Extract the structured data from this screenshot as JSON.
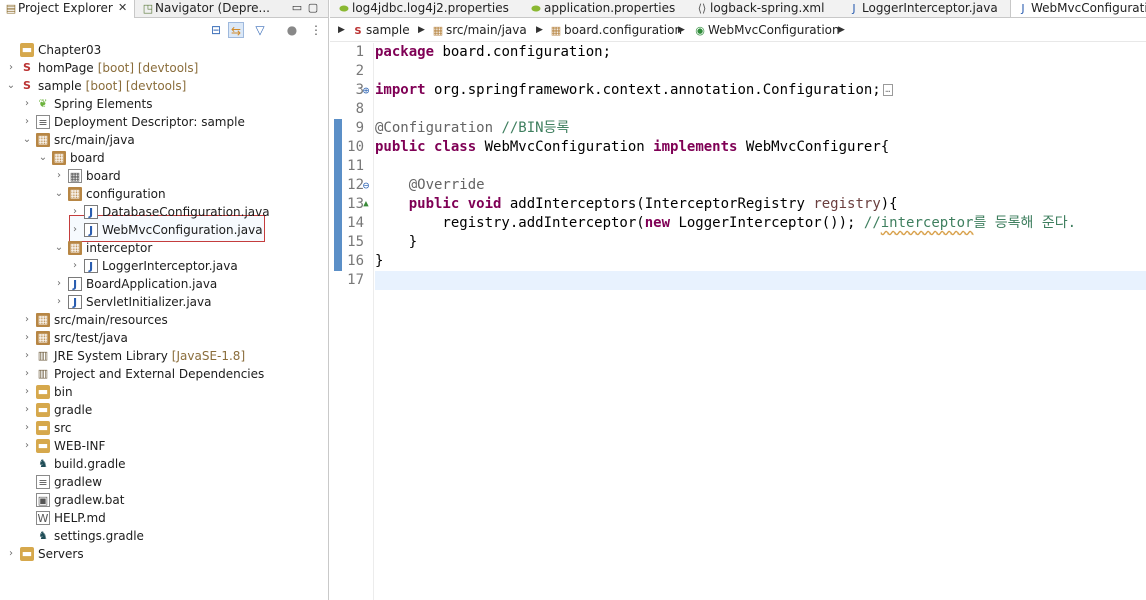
{
  "left_panel": {
    "tabs": [
      {
        "label": "Project Explorer",
        "icon": "project-explorer-icon"
      },
      {
        "label": "Navigator (Depre...",
        "icon": "navigator-icon"
      }
    ],
    "close_glyph": "✕",
    "minimize_glyph": "▭",
    "maximize_glyph": "▢",
    "toolbar": [
      "collapse-all-icon",
      "link-with-editor-icon",
      "filter-icon",
      "focus-icon",
      "view-menu-icon"
    ],
    "tree": [
      {
        "label": "Chapter03",
        "decor": "",
        "icon": "folder"
      },
      {
        "label": "homPage",
        "decor": "[boot] [devtools]",
        "icon": "project"
      },
      {
        "label": "sample",
        "decor": "[boot] [devtools]",
        "icon": "project"
      },
      {
        "label": "Spring Elements",
        "decor": "",
        "icon": "spring"
      },
      {
        "label": "Deployment Descriptor: sample",
        "decor": "",
        "icon": "descriptor"
      },
      {
        "label": "src/main/java",
        "decor": "",
        "icon": "source-folder"
      },
      {
        "label": "board",
        "decor": "",
        "icon": "package"
      },
      {
        "label": "board",
        "decor": "",
        "icon": "package-empty"
      },
      {
        "label": "configuration",
        "decor": "",
        "icon": "package"
      },
      {
        "label": "DatabaseConfiguration.java",
        "decor": "",
        "icon": "java"
      },
      {
        "label": "WebMvcConfiguration.java",
        "decor": "",
        "icon": "java"
      },
      {
        "label": "interceptor",
        "decor": "",
        "icon": "package"
      },
      {
        "label": "LoggerInterceptor.java",
        "decor": "",
        "icon": "java"
      },
      {
        "label": "BoardApplication.java",
        "decor": "",
        "icon": "java"
      },
      {
        "label": "ServletInitializer.java",
        "decor": "",
        "icon": "java"
      },
      {
        "label": "src/main/resources",
        "decor": "",
        "icon": "source-folder"
      },
      {
        "label": "src/test/java",
        "decor": "",
        "icon": "source-folder"
      },
      {
        "label": "JRE System Library",
        "decor": "[JavaSE-1.8]",
        "icon": "library"
      },
      {
        "label": "Project and External Dependencies",
        "decor": "",
        "icon": "library"
      },
      {
        "label": "bin",
        "decor": "",
        "icon": "folder"
      },
      {
        "label": "gradle",
        "decor": "",
        "icon": "folder"
      },
      {
        "label": "src",
        "decor": "",
        "icon": "folder"
      },
      {
        "label": "WEB-INF",
        "decor": "",
        "icon": "folder"
      },
      {
        "label": "build.gradle",
        "decor": "",
        "icon": "gradle"
      },
      {
        "label": "gradlew",
        "decor": "",
        "icon": "file"
      },
      {
        "label": "gradlew.bat",
        "decor": "",
        "icon": "bat"
      },
      {
        "label": "HELP.md",
        "decor": "",
        "icon": "markdown"
      },
      {
        "label": "settings.gradle",
        "decor": "",
        "icon": "gradle"
      },
      {
        "label": "Servers",
        "decor": "",
        "icon": "folder"
      }
    ]
  },
  "editor": {
    "tabs": [
      {
        "label": "log4jdbc.log4j2.properties",
        "icon": "properties-icon"
      },
      {
        "label": "application.properties",
        "icon": "properties-icon"
      },
      {
        "label": "logback-spring.xml",
        "icon": "xml-icon"
      },
      {
        "label": "LoggerInterceptor.java",
        "icon": "java-icon"
      },
      {
        "label": "WebMvcConfigurati",
        "icon": "java-icon"
      }
    ],
    "breadcrumb": [
      "sample",
      "src/main/java",
      "board.configuration",
      "WebMvcConfiguration"
    ],
    "line_numbers": [
      "1",
      "2",
      "3",
      "8",
      "9",
      "10",
      "11",
      "12",
      "13",
      "14",
      "15",
      "16",
      "17"
    ],
    "code": {
      "l1_kw": "package",
      "l1_rest": " board.configuration;",
      "l3_kw": "import",
      "l3_rest": " org.springframework.context.annotation.Configuration;",
      "l9_ann": "@Configuration",
      "l9_cm": " //BIN등록",
      "l10_kw1": "public class",
      "l10_a": " WebMvcConfiguration ",
      "l10_kw2": "implements",
      "l10_b": " WebMvcConfigurer{",
      "l12_ann": "    @Override",
      "l13_kw": "    public void",
      "l13_a": " addInterceptors(InterceptorRegistry ",
      "l13_par": "registry",
      "l13_b": "){",
      "l14_a": "        registry.addInterceptor(",
      "l14_kw": "new",
      "l14_b": " LoggerInterceptor()); ",
      "l14_cm1": "//",
      "l14_cm2": "interceptor",
      "l14_cm3": "를 등록해 준다.",
      "l15": "    }",
      "l16": "}"
    }
  }
}
